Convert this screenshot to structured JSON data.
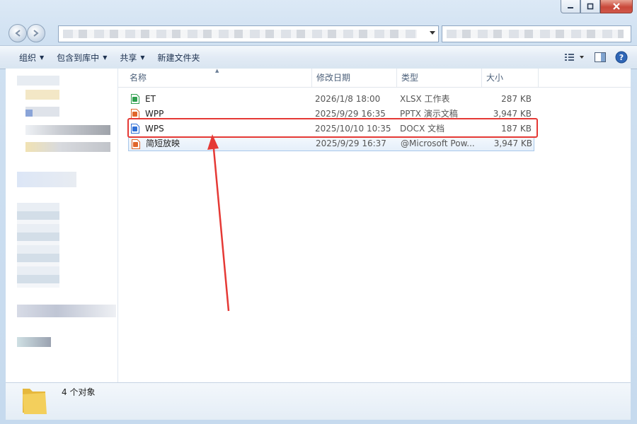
{
  "toolbar": {
    "organize": "组织",
    "include_in_library": "包含到库中",
    "share": "共享",
    "new_folder": "新建文件夹"
  },
  "columns": {
    "name": "名称",
    "date": "修改日期",
    "type": "类型",
    "size": "大小"
  },
  "files": [
    {
      "name": "ET",
      "date": "2026/1/8 18:00",
      "type": "XLSX 工作表",
      "size": "287 KB",
      "icon": "xlsx-file-icon",
      "color": "#2e9f4e"
    },
    {
      "name": "WPP",
      "date": "2025/9/29 16:35",
      "type": "PPTX 演示文稿",
      "size": "3,947 KB",
      "icon": "pptx-file-icon",
      "color": "#e0662a"
    },
    {
      "name": "WPS",
      "date": "2025/10/10 10:35",
      "type": "DOCX 文档",
      "size": "187 KB",
      "icon": "docx-file-icon",
      "color": "#2f6fd6"
    },
    {
      "name": "简短放映",
      "date": "2025/9/29 16:37",
      "type": "@Microsoft Pow...",
      "size": "3,947 KB",
      "icon": "ppsx-file-icon",
      "color": "#e0662a"
    }
  ],
  "status": {
    "count": "4 个对象"
  },
  "colors": {
    "highlight": "#e53935",
    "selection_border": "#a9c8ea"
  }
}
